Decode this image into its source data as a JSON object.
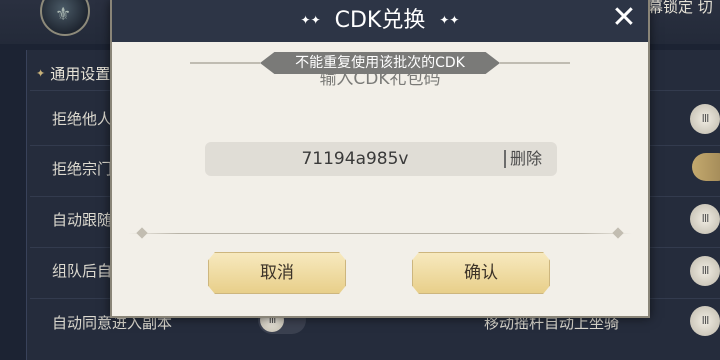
{
  "background": {
    "top_right_text": "幕锁定  切",
    "section_title": "通用设置",
    "rows_left": [
      "拒绝他人",
      "拒绝宗门",
      "自动跟随",
      "组队后自",
      "自动同意进入副本"
    ],
    "row_right": "移动摇杆自动上坐骑",
    "toggle_knob_glyph": "III",
    "avatar_icon_glyph": "⚜"
  },
  "dialog": {
    "title": "CDK兑换",
    "title_deco": "✦✦",
    "close_glyph": "✕",
    "banner": "不能重复使用该批次的CDK",
    "placeholder_under": "输入CDK礼包码",
    "input_value": "71194a985v",
    "delete_label": "删除",
    "cancel_label": "取消",
    "confirm_label": "确认"
  },
  "colors": {
    "dialog_header": "#2d3546",
    "dialog_body": "#f2efe8",
    "button_gold": "#e8cf8a",
    "banner_gray": "#7a7a78"
  }
}
